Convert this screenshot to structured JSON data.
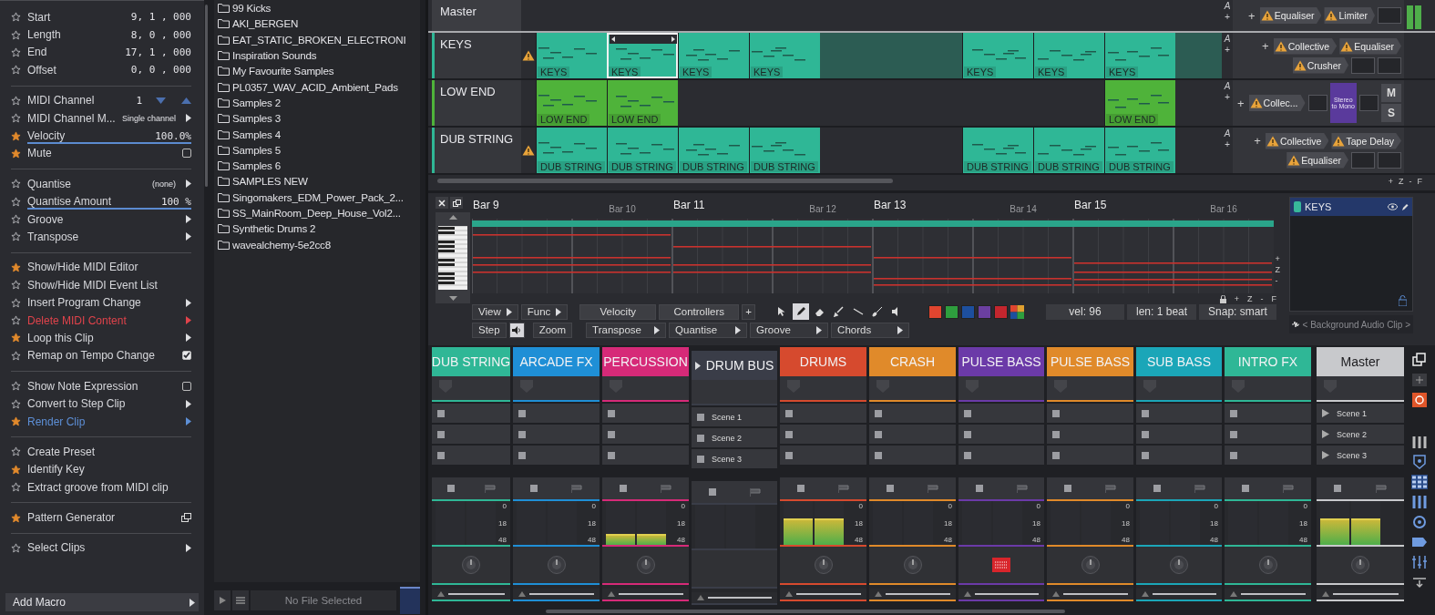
{
  "clip_properties": {
    "sections": [
      [
        {
          "label": "Start",
          "starred": false,
          "kind": "value",
          "value": "9, 1 , 000"
        },
        {
          "label": "Length",
          "starred": false,
          "kind": "value",
          "value": "8, 0 , 000"
        },
        {
          "label": "End",
          "starred": false,
          "kind": "value",
          "value": "17, 1 , 000"
        },
        {
          "label": "Offset",
          "starred": false,
          "kind": "value",
          "value": "0, 0 , 000"
        }
      ],
      [
        {
          "label": "MIDI Channel",
          "starred": false,
          "kind": "stepper",
          "value": "1"
        },
        {
          "label": "MIDI Channel M...",
          "starred": false,
          "kind": "menu",
          "value": "Single channel"
        },
        {
          "label": "Velocity",
          "starred": true,
          "kind": "slider",
          "value": "100.0%",
          "level": 1
        },
        {
          "label": "Mute",
          "starred": true,
          "kind": "checkbox",
          "checked": false
        }
      ],
      [
        {
          "label": "Quantise",
          "starred": false,
          "kind": "menu",
          "value": "(none)"
        },
        {
          "label": "Quantise Amount",
          "starred": false,
          "kind": "slider",
          "value": "100 %",
          "level": 1
        },
        {
          "label": "Groove",
          "starred": false,
          "kind": "menu"
        },
        {
          "label": "Transpose",
          "starred": false,
          "kind": "menu"
        }
      ],
      [
        {
          "label": "Show/Hide MIDI Editor",
          "starred": true,
          "kind": "plain"
        },
        {
          "label": "Show/Hide MIDI Event List",
          "starred": false,
          "kind": "plain"
        },
        {
          "label": "Insert Program Change",
          "starred": false,
          "kind": "menu"
        },
        {
          "label": "Delete MIDI Content",
          "starred": false,
          "kind": "menu",
          "color": "#e0434b"
        },
        {
          "label": "Loop this Clip",
          "starred": true,
          "kind": "menu"
        },
        {
          "label": "Remap on Tempo Change",
          "starred": false,
          "kind": "checkbox",
          "checked": true
        }
      ],
      [
        {
          "label": "Show Note Expression",
          "starred": false,
          "kind": "checkbox",
          "checked": false
        },
        {
          "label": "Convert to Step Clip",
          "starred": false,
          "kind": "menu"
        },
        {
          "label": "Render Clip",
          "starred": true,
          "kind": "menu",
          "color": "#5d8fd6"
        }
      ],
      [
        {
          "label": "Create Preset",
          "starred": false,
          "kind": "plain"
        },
        {
          "label": "Identify Key",
          "starred": true,
          "kind": "plain"
        },
        {
          "label": "Extract groove from MIDI clip",
          "starred": false,
          "kind": "plain"
        }
      ],
      [
        {
          "label": "Pattern Generator",
          "starred": true,
          "kind": "popout"
        }
      ],
      [
        {
          "label": "Select Clips",
          "starred": false,
          "kind": "menu"
        }
      ]
    ],
    "add_macro": "Add Macro"
  },
  "browser": {
    "folders": [
      "99 Kicks",
      "AKI_BERGEN",
      "EAT_STATIC_BROKEN_ELECTRONI",
      "Inspiration Sounds",
      "My Favourite Samples",
      "PL0357_WAV_ACID_Ambient_Pads",
      "Samples 2",
      "Samples 3",
      "Samples 4",
      "Samples 5",
      "Samples 6",
      "SAMPLES NEW",
      "Singomakers_EDM_Power_Pack_2...",
      "SS_MainRoom_Deep_House_Vol2...",
      "Synthetic Drums 2",
      "wavealchemy-5e2cc8"
    ],
    "status": "No File Selected"
  },
  "tracks": [
    {
      "name": "Master",
      "kind": "master",
      "warning": false,
      "markers": [
        "A",
        "+"
      ],
      "plugin_rows": [
        [
          {
            "kind": "add",
            "label": "+"
          },
          {
            "kind": "plugin",
            "label": "Equaliser",
            "warn": true
          },
          {
            "kind": "plugin",
            "label": "Limiter",
            "warn": true
          },
          {
            "kind": "block"
          }
        ]
      ]
    },
    {
      "name": "KEYS",
      "kind": "midi",
      "color": "#2fb796",
      "warning": true,
      "markers": [
        "A",
        "+"
      ],
      "clips": [
        {
          "kind": "clip",
          "label": "KEYS",
          "selected": false
        },
        {
          "kind": "clip",
          "label": "KEYS",
          "selected": true
        },
        {
          "kind": "clip",
          "label": "KEYS",
          "selected": false
        },
        {
          "kind": "clip",
          "label": "KEYS",
          "selected": false
        },
        {
          "kind": "loop"
        },
        {
          "kind": "loop"
        },
        {
          "kind": "clip",
          "label": "KEYS",
          "selected": false
        },
        {
          "kind": "clip",
          "label": "KEYS",
          "selected": false
        },
        {
          "kind": "clip",
          "label": "KEYS",
          "selected": false
        },
        {
          "kind": "loop"
        }
      ],
      "plugin_rows": [
        [
          {
            "kind": "add",
            "label": "+"
          },
          {
            "kind": "plugin",
            "label": "Collective",
            "warn": true
          },
          {
            "kind": "plugin",
            "label": "Equaliser",
            "warn": true
          }
        ],
        [
          {
            "kind": "plugin",
            "label": "Crusher",
            "warn": true
          },
          {
            "kind": "block"
          },
          {
            "kind": "block"
          }
        ]
      ]
    },
    {
      "name": "LOW END",
      "kind": "midi",
      "color": "#4fb33a",
      "warning": false,
      "markers": [
        "A",
        "+"
      ],
      "clips": [
        {
          "kind": "clip",
          "label": "LOW END",
          "selected": false
        },
        {
          "kind": "clip",
          "label": "LOW END",
          "selected": false
        },
        {
          "kind": "empty"
        },
        {
          "kind": "empty"
        },
        {
          "kind": "empty"
        },
        {
          "kind": "empty"
        },
        {
          "kind": "empty"
        },
        {
          "kind": "empty"
        },
        {
          "kind": "clip",
          "label": "LOW END",
          "selected": false
        }
      ],
      "plugin_rows": [
        [
          {
            "kind": "add",
            "label": "+"
          },
          {
            "kind": "plugin",
            "label": "Collec...",
            "warn": true
          },
          {
            "kind": "block"
          },
          {
            "kind": "tile",
            "label": "Stereo to Mono"
          },
          {
            "kind": "block"
          },
          {
            "kind": "ms",
            "labels": [
              "M",
              "S"
            ]
          }
        ]
      ]
    },
    {
      "name": "DUB STRING",
      "kind": "midi",
      "color": "#2fb796",
      "warning": true,
      "markers": [
        "A",
        "+"
      ],
      "clips": [
        {
          "kind": "clip",
          "label": "DUB STRING",
          "selected": false
        },
        {
          "kind": "clip",
          "label": "DUB STRING",
          "selected": false
        },
        {
          "kind": "clip",
          "label": "DUB STRING",
          "selected": false
        },
        {
          "kind": "clip",
          "label": "DUB STRING",
          "selected": false
        },
        {
          "kind": "empty"
        },
        {
          "kind": "empty"
        },
        {
          "kind": "clip",
          "label": "DUB STRING",
          "selected": false
        },
        {
          "kind": "clip",
          "label": "DUB STRING",
          "selected": false
        },
        {
          "kind": "clip",
          "label": "DUB STRING",
          "selected": false
        }
      ],
      "plugin_rows": [
        [
          {
            "kind": "add",
            "label": "+"
          },
          {
            "kind": "plugin",
            "label": "Collective",
            "warn": true
          },
          {
            "kind": "plugin",
            "label": "Tape Delay",
            "warn": true
          }
        ],
        [
          {
            "kind": "plugin",
            "label": "Equaliser",
            "warn": true
          },
          {
            "kind": "block"
          },
          {
            "kind": "block"
          }
        ]
      ]
    }
  ],
  "track_zoom": [
    "+",
    "Z",
    "-",
    "F"
  ],
  "editor": {
    "bars": [
      {
        "label": "Bar 9",
        "major": true
      },
      {
        "label": "Bar 10",
        "major": false
      },
      {
        "label": "Bar 11",
        "major": true
      },
      {
        "label": "Bar 12",
        "major": false
      },
      {
        "label": "Bar 13",
        "major": true
      },
      {
        "label": "Bar 14",
        "major": false
      },
      {
        "label": "Bar 15",
        "major": true
      },
      {
        "label": "Bar 16",
        "major": false
      }
    ],
    "zoom": [
      "+",
      "Z",
      "-"
    ],
    "grid_zoom": [
      "+",
      "Z",
      "-",
      "F"
    ],
    "toolbar_row1": [
      {
        "kind": "menu",
        "label": "View"
      },
      {
        "kind": "menu",
        "label": "Func"
      },
      {
        "kind": "tab",
        "label": "Velocity"
      },
      {
        "kind": "tab",
        "label": "Controllers"
      },
      {
        "kind": "small",
        "label": "+"
      }
    ],
    "toolbar_row2": [
      {
        "kind": "plain",
        "label": "Step"
      },
      {
        "kind": "speaker"
      },
      {
        "kind": "plain",
        "label": "Zoom"
      },
      {
        "kind": "menu",
        "label": "Transpose"
      },
      {
        "kind": "menu",
        "label": "Quantise"
      },
      {
        "kind": "menu",
        "label": "Groove"
      },
      {
        "kind": "menu",
        "label": "Chords"
      }
    ],
    "tools": [
      {
        "kind": "pointer",
        "selected": false
      },
      {
        "kind": "pencil",
        "selected": true
      },
      {
        "kind": "eraser",
        "selected": false
      },
      {
        "kind": "brush",
        "selected": false
      },
      {
        "kind": "line",
        "selected": false
      },
      {
        "kind": "paint",
        "selected": false
      },
      {
        "kind": "speaker",
        "selected": false
      }
    ],
    "swatches": [
      {
        "kind": "solid",
        "color": "#e0452f"
      },
      {
        "kind": "solid",
        "color": "#2e9e3e"
      },
      {
        "kind": "solid",
        "color": "#1d4f9e"
      },
      {
        "kind": "solid",
        "color": "#6b3fa0"
      },
      {
        "kind": "solid",
        "color": "#c4262e"
      },
      {
        "kind": "multi"
      }
    ],
    "readouts": [
      "vel: 96",
      "len: 1 beat",
      "Snap:  smart"
    ],
    "clip_list": [
      {
        "label": "KEYS",
        "color": "#38b89a",
        "selected": true
      }
    ],
    "background_clip": "< Background Audio Clip >"
  },
  "mixer": {
    "channels": [
      {
        "name": "DUB STRING",
        "kind": "audio",
        "color": "#2fb796",
        "scale": [
          "0",
          "18",
          "48"
        ],
        "insert": {
          "kind": "knob"
        }
      },
      {
        "name": "ARCADE FX",
        "kind": "audio",
        "color": "#1f8fd6",
        "scale": [
          "0",
          "18",
          "48"
        ],
        "insert": {
          "kind": "knob"
        }
      },
      {
        "name": "PERCUSSION",
        "kind": "audio",
        "color": "#d62a78",
        "level": 0.25,
        "scale": [
          "0",
          "18",
          "48"
        ],
        "insert": {
          "kind": "knob"
        }
      },
      {
        "name": "DRUM BUS",
        "kind": "bus",
        "color": "#3a3d48",
        "scenes": [
          "Scene 1",
          "Scene 2",
          "Scene 3"
        ]
      },
      {
        "name": "DRUMS",
        "kind": "audio",
        "color": "#d64a2e",
        "level": 0.6,
        "scale": [
          "0",
          "18",
          "48"
        ],
        "insert": {
          "kind": "knob"
        }
      },
      {
        "name": "CRASH",
        "kind": "audio",
        "color": "#e08a2a",
        "scale": [
          "0",
          "18",
          "48"
        ],
        "insert": {
          "kind": "knob"
        }
      },
      {
        "name": "PULSE BASS",
        "kind": "audio",
        "color": "#6b3aa8",
        "scale": [
          "0",
          "18",
          "48"
        ],
        "insert": {
          "kind": "plugin"
        }
      },
      {
        "name": "PULSE BASS",
        "kind": "audio",
        "color": "#e08a2a",
        "scale": [
          "0",
          "18",
          "48"
        ],
        "insert": {
          "kind": "knob"
        }
      },
      {
        "name": "SUB BASS",
        "kind": "audio",
        "color": "#1ba6b8",
        "scale": [
          "0",
          "18",
          "48"
        ],
        "insert": {
          "kind": "knob"
        }
      },
      {
        "name": "INTRO FX",
        "kind": "audio",
        "color": "#2fb796",
        "scale": [
          "0",
          "18",
          "48"
        ],
        "insert": {
          "kind": "knob"
        }
      },
      {
        "name": "Master",
        "kind": "master",
        "color": "#c8c9cc",
        "level": 0.6,
        "scenes": [
          "Scene 1",
          "Scene 2",
          "Scene 3"
        ],
        "insert": {
          "kind": "knob"
        }
      }
    ]
  }
}
